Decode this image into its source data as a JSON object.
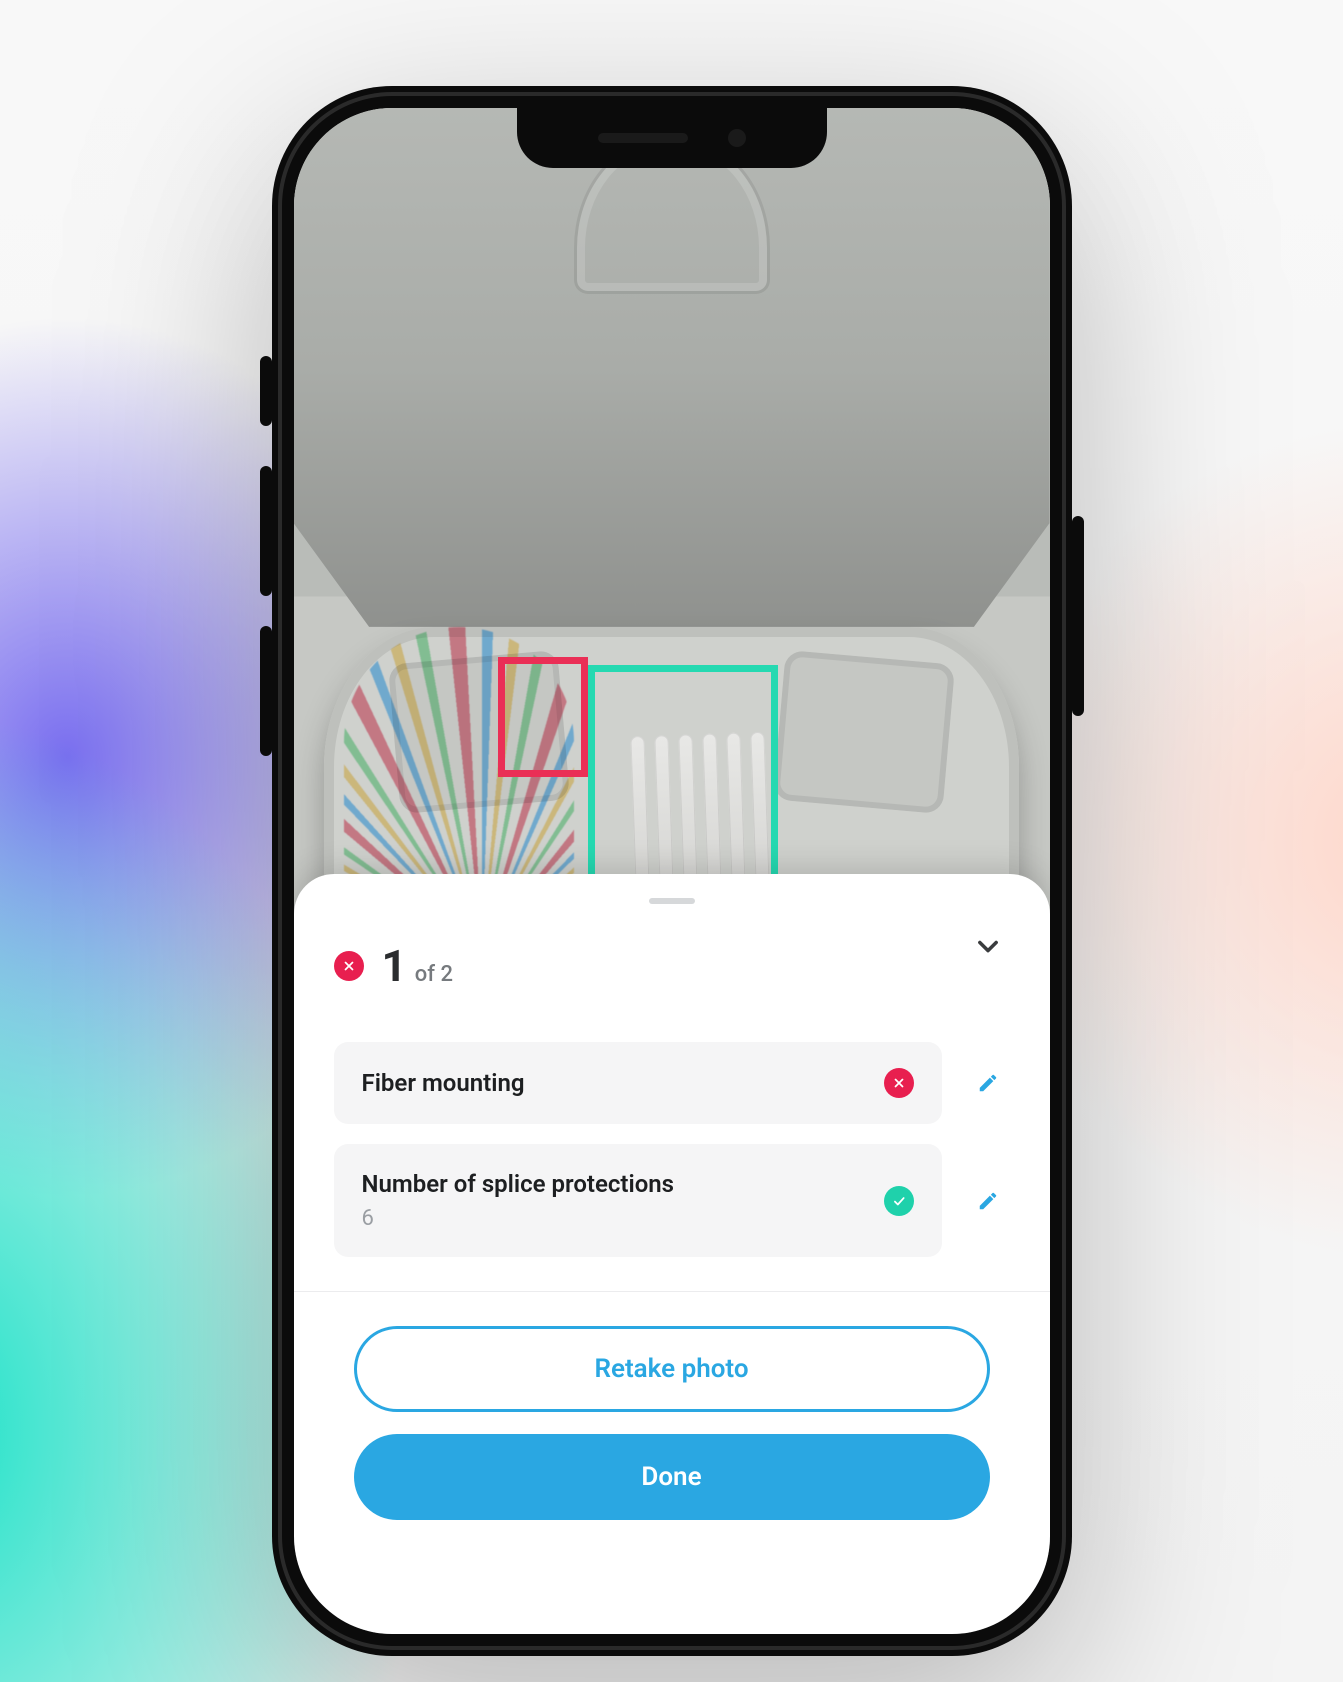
{
  "sheet": {
    "counter_current": "1",
    "counter_total_label": "of 2",
    "overall_status": "error"
  },
  "items": [
    {
      "title": "Fiber mounting",
      "value": "",
      "status": "error"
    },
    {
      "title": "Number of splice protections",
      "value": "6",
      "status": "ok"
    }
  ],
  "actions": {
    "retake_label": "Retake photo",
    "done_label": "Done"
  },
  "detections": {
    "error_box_color": "#ea2f56",
    "ok_box_color": "#25d9b1"
  },
  "colors": {
    "accent": "#2aa7e2",
    "error": "#e81f4f",
    "success": "#1fd1ab"
  }
}
